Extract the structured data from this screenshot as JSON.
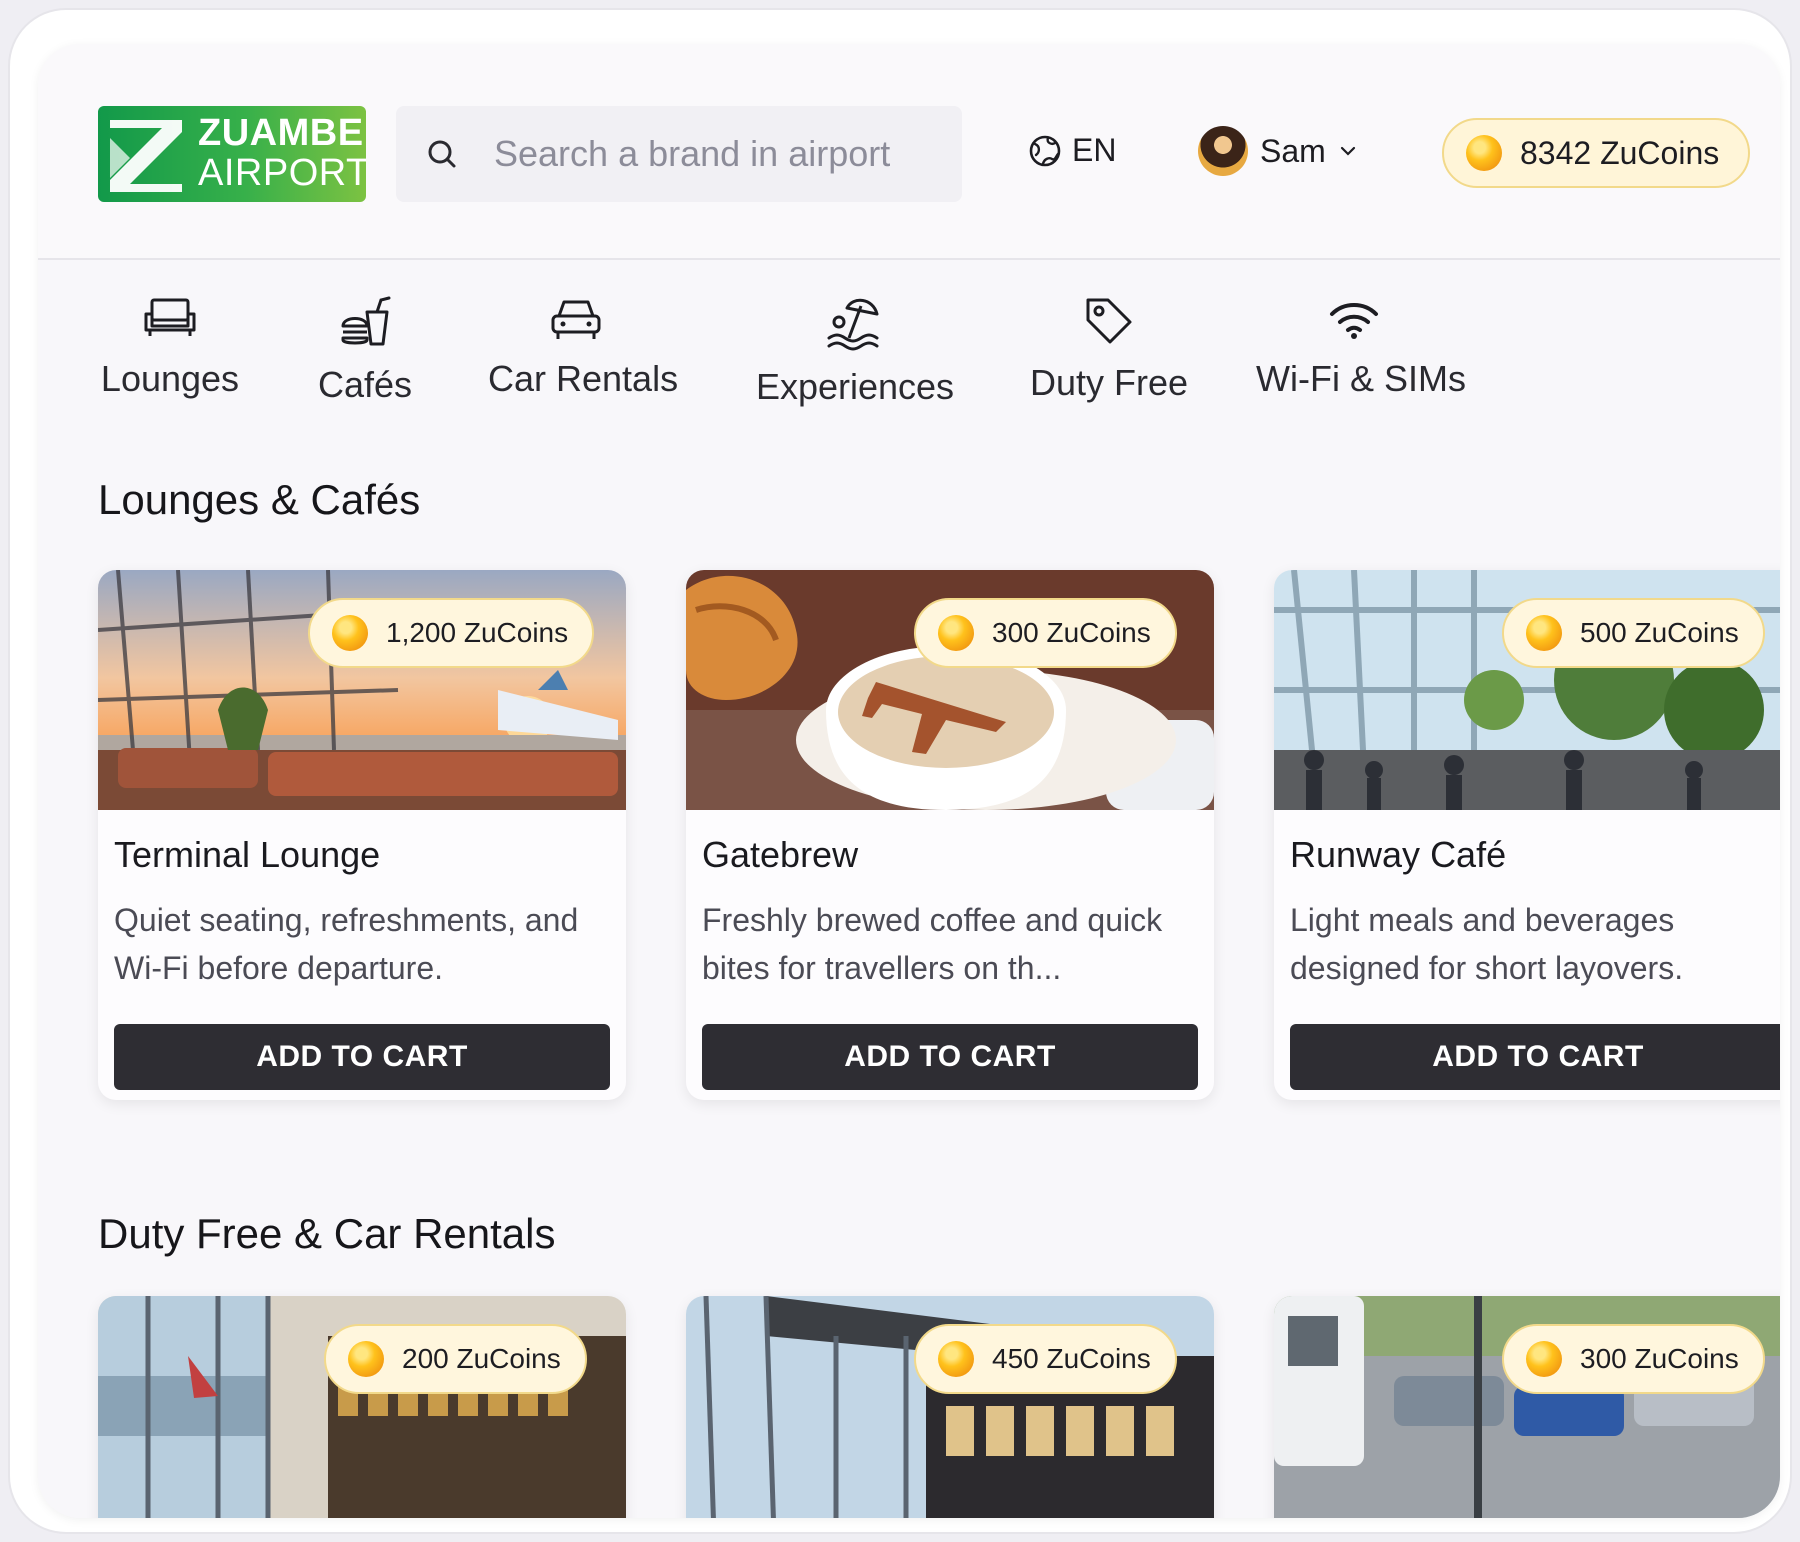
{
  "header": {
    "logo": {
      "line1": "ZUAMBE",
      "line2": "AIRPORT"
    },
    "search_placeholder": "Search a brand in airport",
    "language": "EN",
    "user_name": "Sam",
    "coins_balance": "8342 ZuCoins"
  },
  "categories": [
    {
      "label": "Lounges",
      "icon": "sofa-icon"
    },
    {
      "label": "Cafés",
      "icon": "burger-drink-icon"
    },
    {
      "label": "Car Rentals",
      "icon": "car-icon"
    },
    {
      "label": "Experiences",
      "icon": "beach-umbrella-icon"
    },
    {
      "label": "Duty Free",
      "icon": "tag-icon"
    },
    {
      "label": "Wi-Fi & SIMs",
      "icon": "wifi-icon"
    }
  ],
  "sections": [
    {
      "title": "Lounges & Cafés",
      "cards": [
        {
          "price": "1,200 ZuCoins",
          "name": "Terminal Lounge",
          "desc": "Quiet seating, refreshments, and Wi-Fi before departure.",
          "button": "ADD TO CART"
        },
        {
          "price": "300 ZuCoins",
          "name": "Gatebrew",
          "desc": "Freshly brewed coffee and quick bites for travellers on th...",
          "button": "ADD TO CART"
        },
        {
          "price": "500 ZuCoins",
          "name": "Runway Café",
          "desc": "Light meals and beverages designed for short layovers.",
          "button": "ADD TO CART"
        }
      ]
    },
    {
      "title": "Duty Free & Car Rentals",
      "cards": [
        {
          "price": "200 ZuCoins"
        },
        {
          "price": "450 ZuCoins"
        },
        {
          "price": "300 ZuCoins"
        }
      ]
    }
  ],
  "colors": {
    "accent_green": "#37b04a",
    "coin_gold": "#ffc21c",
    "button_dark": "#2e2d33",
    "badge_bg": "#fff6dd"
  }
}
